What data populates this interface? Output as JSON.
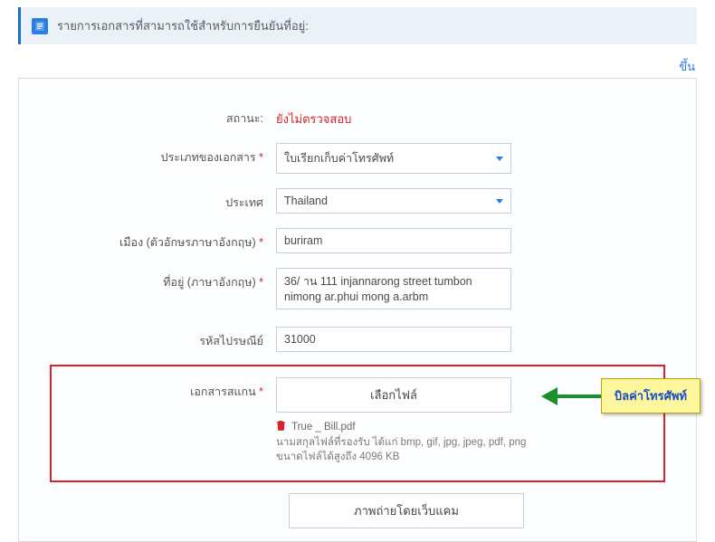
{
  "info_bar": "รายการเอกสารที่สามารถใช้สำหรับการยืนยันที่อยู่:",
  "top_link": "ขึ้น",
  "labels": {
    "status": "สถานะ:",
    "doc_type": "ประเภทของเอกสาร",
    "country": "ประเทศ",
    "city": "เมือง (ตัวอักษรภาษาอังกฤษ)",
    "address": "ที่อยู่ (ภาษาอังกฤษ)",
    "postal": "รหัสไปรษณีย์",
    "scan": "เอกสารสแกน"
  },
  "required_mark": "*",
  "values": {
    "status": "ยังไม่ตรวจสอบ",
    "doc_type": "ใบเรียกเก็บค่าโทรศัพท์",
    "country": "Thailand",
    "city": "buriram",
    "address": "36/ าน 111 injannarong street tumbon nimong ar.phui mong a.arbm",
    "postal": "31000"
  },
  "file": {
    "choose_label": "เลือกไฟล์",
    "name": "True _ Bill.pdf",
    "hint": "นามสกุลไฟล์ที่รองรับ ได้แก่ bmp, gif, jpg, jpeg, pdf, png ขนาดไฟล์ได้สูงถึง 4096 KB"
  },
  "webcam_label": "ภาพถ่ายโดยเว็บแคม",
  "callout": "บิลค่าโทรศัพท์"
}
